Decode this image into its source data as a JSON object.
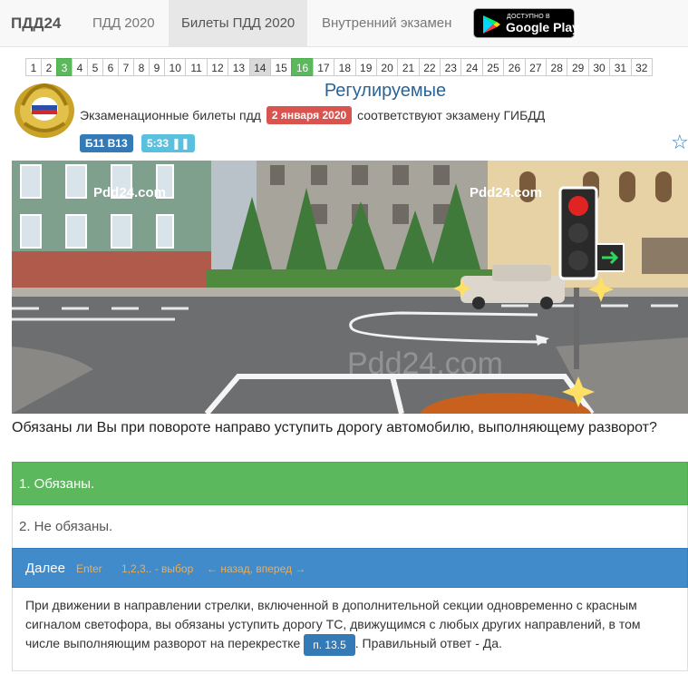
{
  "nav": {
    "brand": "ПДД24",
    "items": [
      {
        "label": "ПДД 2020"
      },
      {
        "label": "Билеты ПДД 2020"
      },
      {
        "label": "Внутренний экзамен"
      }
    ],
    "google_play": {
      "small": "ДОСТУПНО В",
      "big": "Google Play"
    }
  },
  "pages": [
    "1",
    "2",
    "3",
    "4",
    "5",
    "6",
    "7",
    "8",
    "9",
    "10",
    "11",
    "12",
    "13",
    "14",
    "15",
    "16",
    "17",
    "18",
    "19",
    "20",
    "21",
    "22",
    "23",
    "24",
    "25",
    "26",
    "27",
    "28",
    "29",
    "30",
    "31",
    "32"
  ],
  "header": {
    "topic": "Регулируемые",
    "sub_before": "Экзаменационные билеты пдд",
    "date": "2 января 2020",
    "sub_after": "соответствуют экзамену ГИБДД",
    "ticket_badge": "Б11 В13",
    "timer": "5:33"
  },
  "scene": {
    "watermark": "Pdd24.com"
  },
  "question": "Обязаны ли Вы при повороте направо уступить дорогу автомобилю, выполняющему разворот?",
  "answers": [
    {
      "label": "1. Обязаны."
    },
    {
      "label": "2. Не обязаны."
    }
  ],
  "next_bar": {
    "label": "Далее",
    "hint_enter": "Enter",
    "hint_select": "1,2,3.. - выбор",
    "hint_nav": "← назад, вперед →"
  },
  "explanation": {
    "text_before": "При движении в направлении стрелки, включенной в дополнительной секции одновременно с красным сигналом светофора, вы обязаны уступить дорогу ТС, движущимся с любых других направлений, в том числе выполняющим разворот на перекрестке",
    "rule_link": "п. 13.5",
    "text_after": ". Правильный ответ - Да."
  },
  "colors": {
    "correct": "#5cb85c",
    "primary": "#428bca",
    "danger": "#d9534f",
    "info": "#5bc0de"
  }
}
